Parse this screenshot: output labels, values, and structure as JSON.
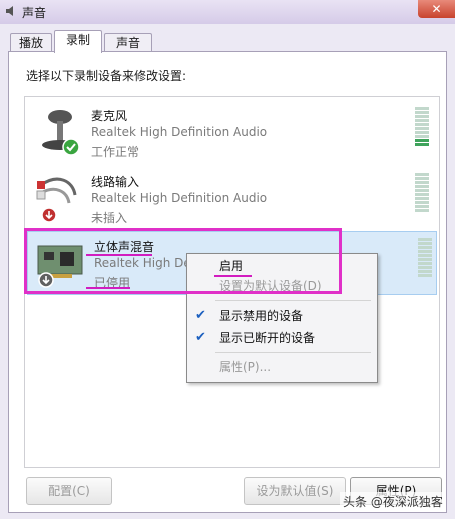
{
  "window": {
    "title": "声音",
    "close_symbol": "✕"
  },
  "tabs": [
    {
      "label": "播放",
      "active": false
    },
    {
      "label": "录制",
      "active": true
    },
    {
      "label": "声音",
      "active": false
    }
  ],
  "instruction": "选择以下录制设备来修改设置:",
  "devices": [
    {
      "name": "麦克风",
      "driver": "Realtek High Definition Audio",
      "status": "工作正常",
      "status_icon": "green-check-icon",
      "meter_active_bars": 2
    },
    {
      "name": "线路输入",
      "driver": "Realtek High Definition Audio",
      "status": "未插入",
      "status_icon": "red-down-arrow-icon",
      "meter_active_bars": 0
    },
    {
      "name": "立体声混音",
      "driver": "Realtek High Defi",
      "status": "已停用",
      "status_icon": "gray-down-arrow-icon",
      "meter_active_bars": 0,
      "selected": true
    }
  ],
  "context_menu": {
    "items": [
      {
        "label": "启用",
        "enabled": true,
        "checked": false
      },
      {
        "label": "设置为默认设备(D)",
        "enabled": false,
        "checked": false
      },
      {
        "label": "显示禁用的设备",
        "enabled": true,
        "checked": true
      },
      {
        "label": "显示已断开的设备",
        "enabled": true,
        "checked": true
      },
      {
        "label": "属性(P)...",
        "enabled": false,
        "checked": false
      }
    ],
    "check_symbol": "✔"
  },
  "buttons": {
    "configure": "配置(C)",
    "set_default": "设为默认值(S)",
    "properties": "属性(P)"
  },
  "watermark": "头条 @夜深派独客",
  "colors": {
    "annotation_magenta": "#e030c8",
    "selection_blue": "#d9eaf9",
    "meter_green": "#3ea35b"
  }
}
